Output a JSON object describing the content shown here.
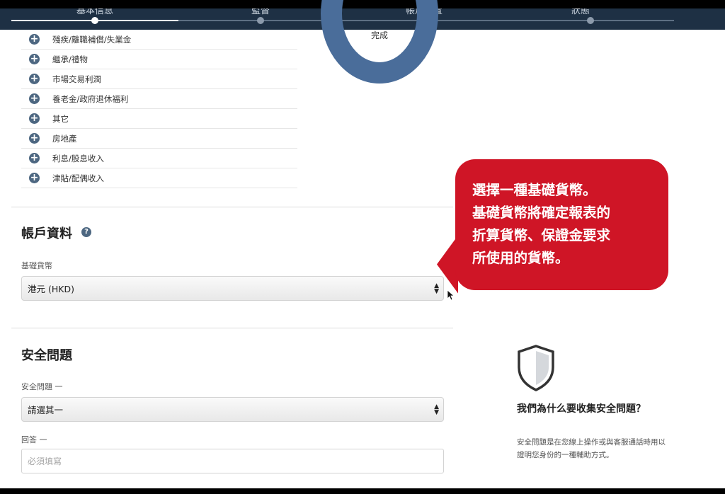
{
  "steps": [
    {
      "label": "基本信息",
      "active": true
    },
    {
      "label": "監督"
    },
    {
      "label": "帳戶設置"
    },
    {
      "label": "狀態"
    }
  ],
  "progress": {
    "center_label": "完成"
  },
  "income_sources": [
    "殘疾/離職補償/失業金",
    "繼承/禮物",
    "市場交易利潤",
    "養老金/政府退休福利",
    "其它",
    "房地產",
    "利息/股息收入",
    "津貼/配偶收入"
  ],
  "account": {
    "title": "帳戶資料",
    "help_icon": "question-circle-icon",
    "base_currency_label": "基礎貨幣",
    "base_currency_value": "港元 (HKD)"
  },
  "security": {
    "title": "安全問題",
    "question1_label": "安全問題 一",
    "question1_value": "請選其一",
    "answer1_label": "回答 一",
    "answer1_placeholder": "必須填寫"
  },
  "callout": {
    "lines": [
      "選擇一種基礎貨幣。",
      "基礎貨幣將確定報表的",
      "折算貨幣、保證金要求",
      "所使用的貨幣。"
    ],
    "color": "#cf1526"
  },
  "info": {
    "icon": "shield-icon",
    "title": "我們為什么要收集安全問題？",
    "body": "安全問題是在您線上操作或與客服通話時用以證明您身份的一種輔助方式。"
  },
  "colors": {
    "nav_bg": "#1e3044",
    "donut": "#4a6d9a",
    "accent": "#4d6781"
  }
}
